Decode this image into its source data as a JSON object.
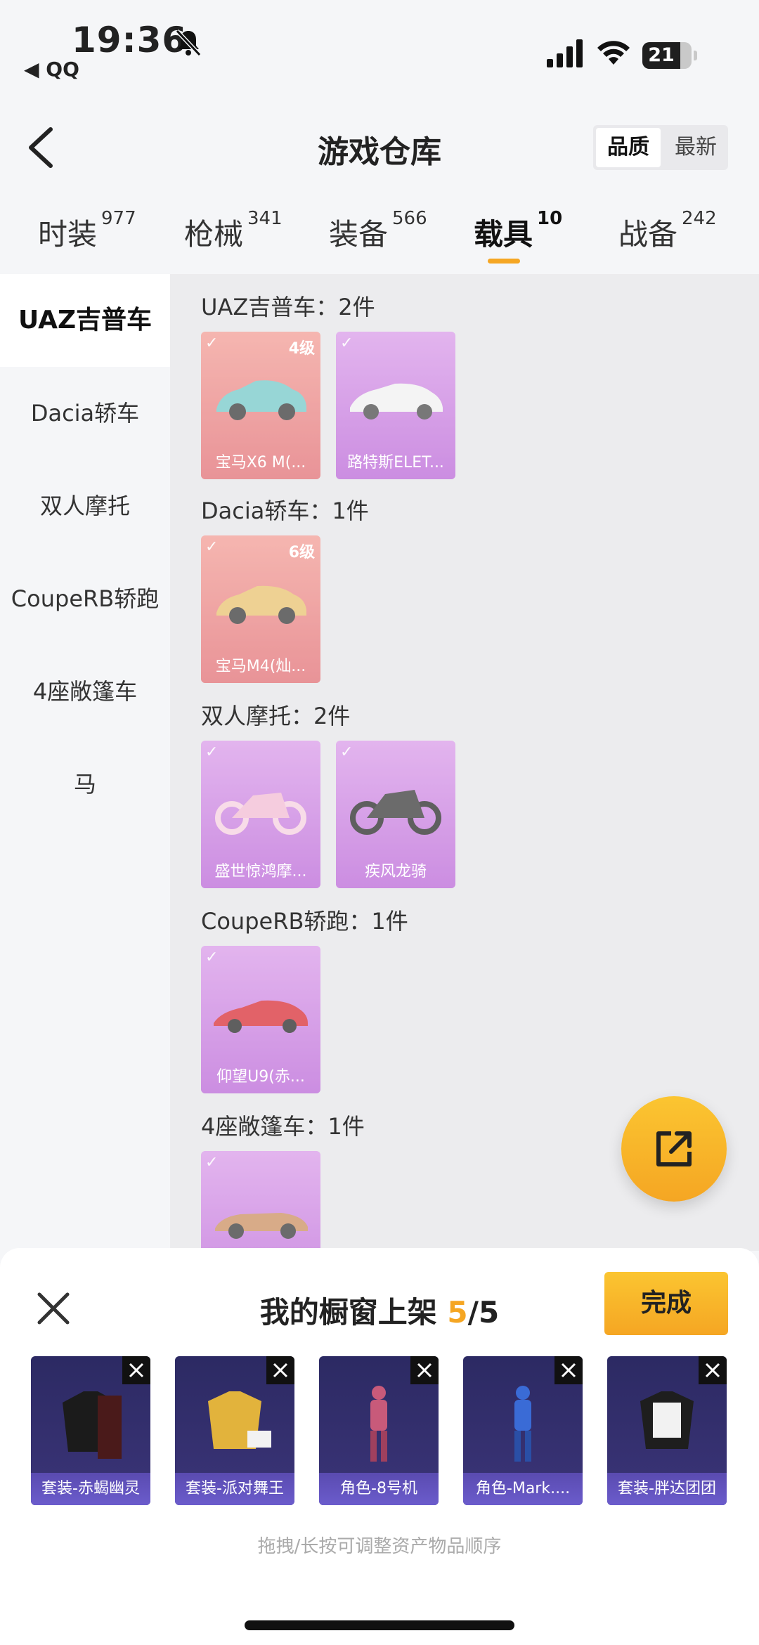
{
  "status": {
    "time": "19:36",
    "back_app": "◀ QQ",
    "battery": "21"
  },
  "header": {
    "title": "游戏仓库",
    "sort_quality": "品质",
    "sort_latest": "最新"
  },
  "tabs": [
    {
      "label": "时装",
      "count": "977"
    },
    {
      "label": "枪械",
      "count": "341"
    },
    {
      "label": "装备",
      "count": "566"
    },
    {
      "label": "载具",
      "count": "10"
    },
    {
      "label": "战备",
      "count": "242"
    }
  ],
  "sidebar": [
    "UAZ吉普车",
    "Dacia轿车",
    "双人摩托",
    "CoupeRB轿跑",
    "4座敞篷车",
    "马"
  ],
  "groups": [
    {
      "title": "UAZ吉普车：2件",
      "items": [
        {
          "name": "宝马X6 M(...",
          "level": "4级",
          "color": "red"
        },
        {
          "name": "路特斯ELET...",
          "level": "",
          "color": "purple"
        }
      ]
    },
    {
      "title": "Dacia轿车：1件",
      "items": [
        {
          "name": "宝马M4(灿...",
          "level": "6级",
          "color": "red"
        }
      ]
    },
    {
      "title": "双人摩托：2件",
      "items": [
        {
          "name": "盛世惊鸿摩...",
          "level": "",
          "color": "purple"
        },
        {
          "name": "疾风龙骑",
          "level": "",
          "color": "purple"
        }
      ]
    },
    {
      "title": "CoupeRB轿跑：1件",
      "items": [
        {
          "name": "仰望U9(赤...",
          "level": "",
          "color": "purple"
        }
      ]
    },
    {
      "title": "4座敞篷车：1件",
      "items": [
        {
          "name": "",
          "level": "",
          "color": "purple"
        }
      ]
    }
  ],
  "sheet": {
    "title": "我的橱窗上架",
    "count_current": "5",
    "count_total": "/5",
    "done": "完成",
    "hint": "拖拽/长按可调整资产物品顺序",
    "items": [
      "套装-赤蝎幽灵",
      "套装-派对舞王",
      "角色-8号机",
      "角色-Mark....",
      "套装-胖达团团"
    ]
  },
  "colors": {
    "accent": "#f5a623",
    "card_red": "#e06a70",
    "card_purple": "#b862d6",
    "shelf_bg": "#2c2a63"
  }
}
